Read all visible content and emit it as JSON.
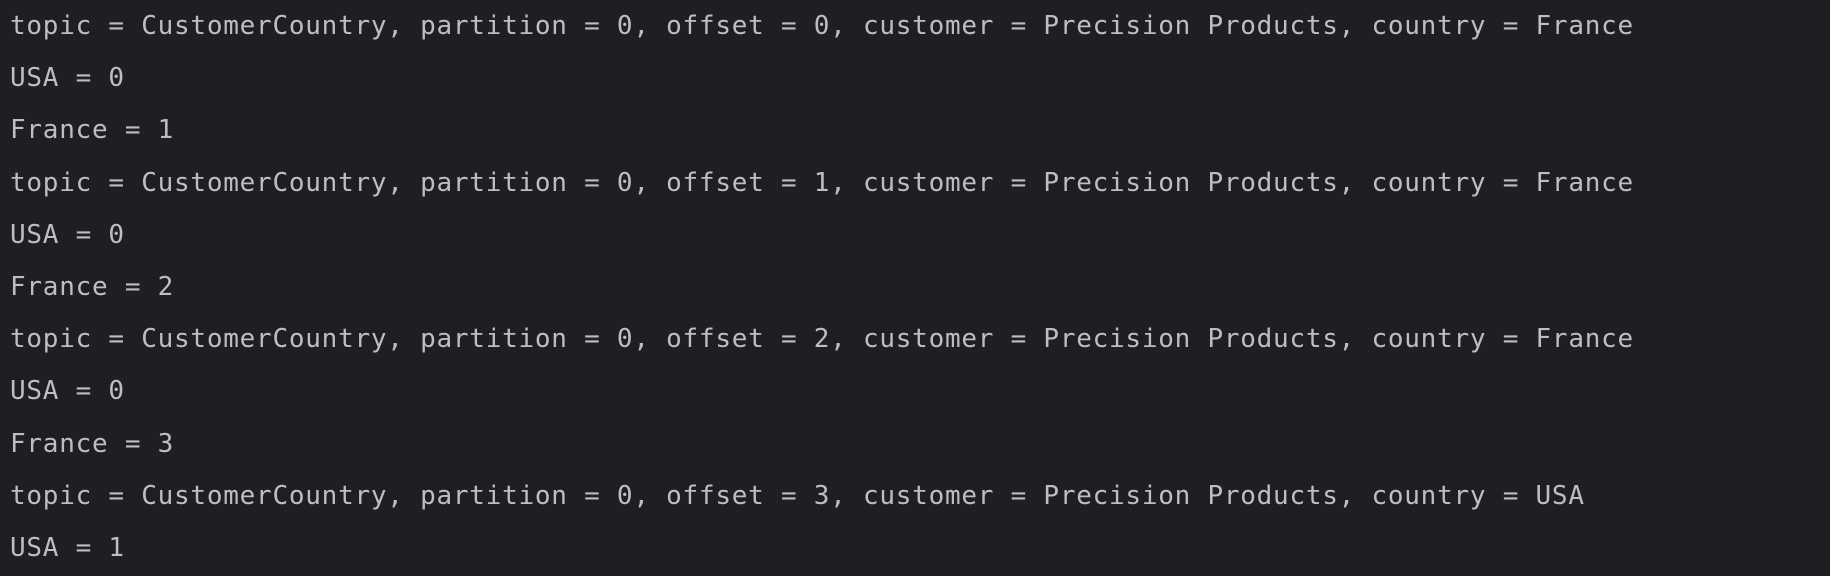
{
  "console": {
    "lines": [
      "topic = CustomerCountry, partition = 0, offset = 0, customer = Precision Products, country = France",
      "USA = 0",
      "France = 1",
      "topic = CustomerCountry, partition = 0, offset = 1, customer = Precision Products, country = France",
      "USA = 0",
      "France = 2",
      "topic = CustomerCountry, partition = 0, offset = 2, customer = Precision Products, country = France",
      "USA = 0",
      "France = 3",
      "topic = CustomerCountry, partition = 0, offset = 3, customer = Precision Products, country = USA",
      "USA = 1"
    ]
  }
}
